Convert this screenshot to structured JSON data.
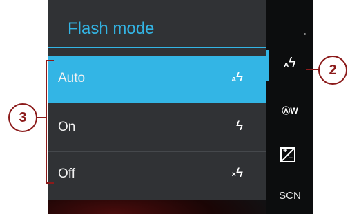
{
  "dialog": {
    "title": "Flash mode",
    "options": [
      {
        "label": "Auto",
        "icon": "flash-auto-icon",
        "selected": true
      },
      {
        "label": "On",
        "icon": "flash-on-icon",
        "selected": false
      },
      {
        "label": "Off",
        "icon": "flash-off-icon",
        "selected": false
      }
    ]
  },
  "sidebar": {
    "items": [
      {
        "icon": "flash-auto-icon"
      },
      {
        "icon": "auto-white-balance-icon",
        "text": "W"
      },
      {
        "icon": "exposure-compensation-icon"
      },
      {
        "label": "SCN"
      }
    ]
  },
  "callouts": {
    "c2": "2",
    "c3": "3"
  },
  "colors": {
    "accent": "#33b5e5",
    "callout": "#8b1a1a"
  }
}
